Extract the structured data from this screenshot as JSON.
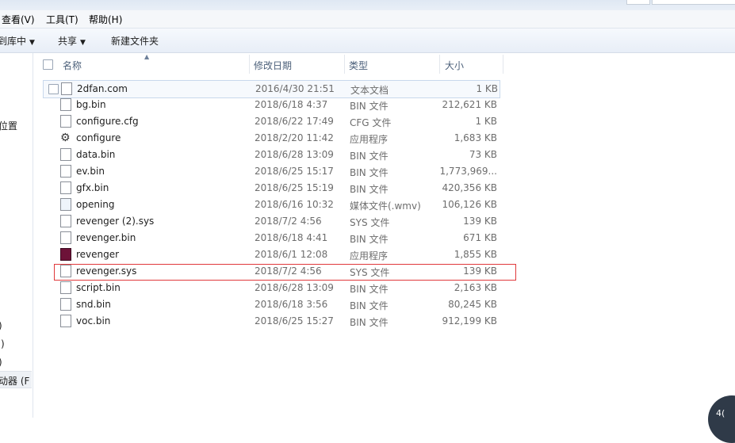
{
  "menu": {
    "items": [
      "查看(V)",
      "工具(T)",
      "帮助(H)"
    ]
  },
  "toolbar": {
    "library_label": "到库中",
    "share_label": "共享",
    "new_folder_label": "新建文件夹"
  },
  "nav": {
    "items": [
      "位置",
      ")",
      ":)",
      ")",
      "动器 (F"
    ]
  },
  "columns": {
    "name": "名称",
    "date": "修改日期",
    "type": "类型",
    "size": "大小"
  },
  "files": [
    {
      "name": "2dfan.com",
      "date": "2016/4/30 21:51",
      "type": "文本文档",
      "size": "1 KB",
      "icon": "text-file-icon"
    },
    {
      "name": "bg.bin",
      "date": "2018/6/18 4:37",
      "type": "BIN 文件",
      "size": "212,621 KB",
      "icon": "file-icon"
    },
    {
      "name": "configure.cfg",
      "date": "2018/6/22 17:49",
      "type": "CFG 文件",
      "size": "1 KB",
      "icon": "file-icon"
    },
    {
      "name": "configure",
      "date": "2018/2/20 11:42",
      "type": "应用程序",
      "size": "1,683 KB",
      "icon": "gear-app-icon"
    },
    {
      "name": "data.bin",
      "date": "2018/6/28 13:09",
      "type": "BIN 文件",
      "size": "73 KB",
      "icon": "file-icon"
    },
    {
      "name": "ev.bin",
      "date": "2018/6/25 15:17",
      "type": "BIN 文件",
      "size": "1,773,969...",
      "icon": "file-icon"
    },
    {
      "name": "gfx.bin",
      "date": "2018/6/25 15:19",
      "type": "BIN 文件",
      "size": "420,356 KB",
      "icon": "file-icon"
    },
    {
      "name": "opening",
      "date": "2018/6/16 10:32",
      "type": "媒体文件(.wmv)",
      "size": "106,126 KB",
      "icon": "media-file-icon"
    },
    {
      "name": "revenger (2).sys",
      "date": "2018/7/2 4:56",
      "type": "SYS 文件",
      "size": "139 KB",
      "icon": "sys-file-icon"
    },
    {
      "name": "revenger.bin",
      "date": "2018/6/18 4:41",
      "type": "BIN 文件",
      "size": "671 KB",
      "icon": "file-icon"
    },
    {
      "name": "revenger",
      "date": "2018/6/1 12:08",
      "type": "应用程序",
      "size": "1,855 KB",
      "icon": "revenger-app-icon"
    },
    {
      "name": "revenger.sys",
      "date": "2018/7/2 4:56",
      "type": "SYS 文件",
      "size": "139 KB",
      "icon": "sys-file-icon"
    },
    {
      "name": "script.bin",
      "date": "2018/6/28 13:09",
      "type": "BIN 文件",
      "size": "2,163 KB",
      "icon": "file-icon"
    },
    {
      "name": "snd.bin",
      "date": "2018/6/18 3:56",
      "type": "BIN 文件",
      "size": "80,245 KB",
      "icon": "file-icon"
    },
    {
      "name": "voc.bin",
      "date": "2018/6/25 15:27",
      "type": "BIN 文件",
      "size": "912,199 KB",
      "icon": "file-icon"
    }
  ],
  "corner_badge": "4("
}
